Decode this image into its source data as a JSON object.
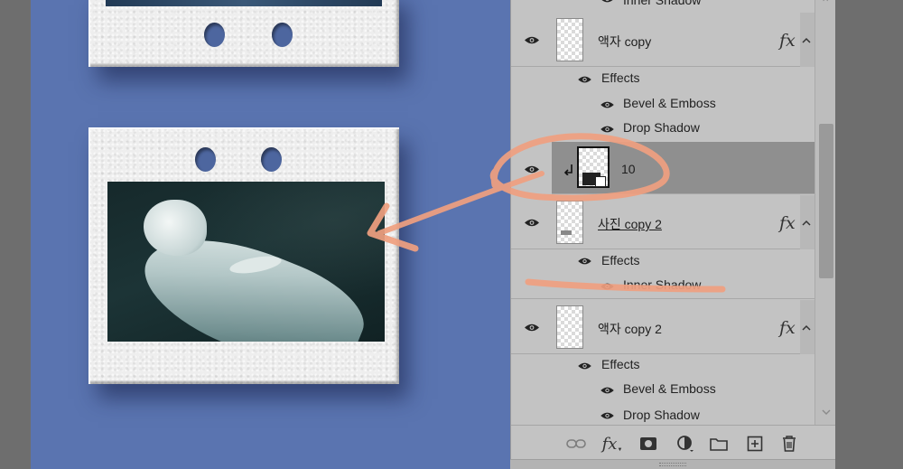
{
  "layers": [
    {
      "name": "액자 copy",
      "fx": "fx",
      "effects_label": "Effects",
      "effects": [
        "Bevel & Emboss",
        "Drop Shadow"
      ]
    },
    {
      "name": "10",
      "selected": true
    },
    {
      "name": "사진 copy 2",
      "fx": "fx",
      "effects_label": "Effects",
      "effects": [
        "Inner Shadow"
      ]
    },
    {
      "name": "액자 copy 2",
      "fx": "fx",
      "effects_label": "Effects",
      "effects": [
        "Bevel & Emboss",
        "Drop Shadow"
      ]
    }
  ],
  "partial_top_effect": "Inner Shadow",
  "footer": {
    "fx_label": "fx",
    "tools": [
      "link-icon",
      "fx-icon",
      "mask-icon",
      "adjustment-icon",
      "folder-icon",
      "new-layer-icon",
      "trash-icon"
    ]
  },
  "colors": {
    "canvas_bg": "#5a74b0",
    "panel_bg": "#c3c3c3",
    "selected_row": "#8f8f8f",
    "annotation": "#f0a080"
  }
}
